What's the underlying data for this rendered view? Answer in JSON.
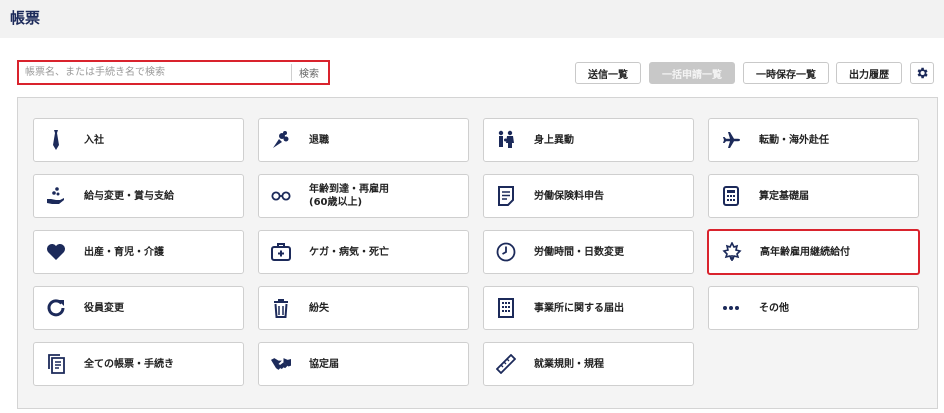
{
  "page": {
    "title": "帳票"
  },
  "search": {
    "placeholder": "帳票名、または手続き名で検索",
    "value": "",
    "button": "検索"
  },
  "toolbar": {
    "sent_list": "送信一覧",
    "bulk_list": "一括申請一覧",
    "temp_saved_list": "一時保存一覧",
    "output_history": "出力履歴",
    "settings_icon": "gear-icon"
  },
  "colors": {
    "accent": "#1c2a5a",
    "highlight": "#d9232d",
    "disabled": "#c8c8c8"
  },
  "cards": [
    {
      "label": "入社",
      "icon": "necktie-icon"
    },
    {
      "label": "退職",
      "icon": "bouquet-icon"
    },
    {
      "label": "身上異動",
      "icon": "family-icon"
    },
    {
      "label": "転勤・海外赴任",
      "icon": "airplane-icon"
    },
    {
      "label": "給与変更・賞与支給",
      "icon": "coins-hand-icon"
    },
    {
      "label": "年齢到達・再雇用\n(60歳以上)",
      "icon": "glasses-icon"
    },
    {
      "label": "労働保険料申告",
      "icon": "document-icon"
    },
    {
      "label": "算定基礎届",
      "icon": "calculator-icon"
    },
    {
      "label": "出産・育児・介護",
      "icon": "heart-icon"
    },
    {
      "label": "ケガ・病気・死亡",
      "icon": "first-aid-icon"
    },
    {
      "label": "労働時間・日数変更",
      "icon": "clock-icon"
    },
    {
      "label": "高年齢雇用継続給付",
      "icon": "maple-leaf-icon",
      "highlighted": true
    },
    {
      "label": "役員変更",
      "icon": "refresh-icon"
    },
    {
      "label": "紛失",
      "icon": "trash-icon"
    },
    {
      "label": "事業所に関する届出",
      "icon": "building-icon"
    },
    {
      "label": "その他",
      "icon": "more-icon"
    },
    {
      "label": "全ての帳票・手続き",
      "icon": "documents-icon"
    },
    {
      "label": "協定届",
      "icon": "handshake-icon"
    },
    {
      "label": "就業規則・規程",
      "icon": "ruler-icon"
    }
  ]
}
